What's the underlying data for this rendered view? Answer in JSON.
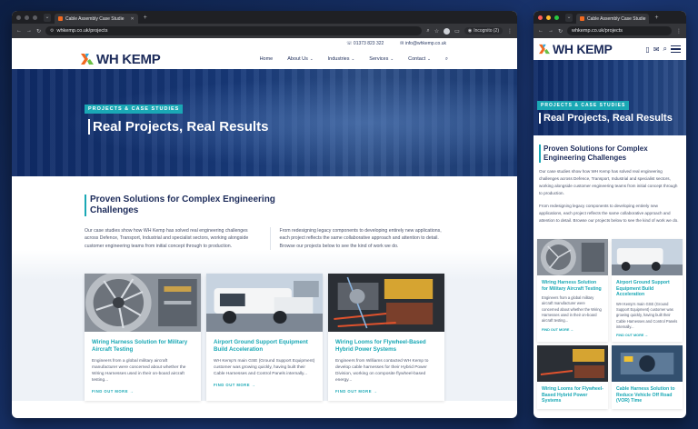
{
  "browser": {
    "tab_title": "Cable Assembly Case Studie",
    "url": "whkemp.co.uk/projects",
    "incognito_label": "Incognito (2)"
  },
  "header": {
    "phone": "01373 823 322",
    "email": "info@whkemp.co.uk",
    "logo_text": "WH KEMP",
    "menu": [
      {
        "label": "Home"
      },
      {
        "label": "About Us"
      },
      {
        "label": "Industries"
      },
      {
        "label": "Services"
      },
      {
        "label": "Contact"
      }
    ]
  },
  "hero": {
    "badge": "PROJECTS & CASE STUDIES",
    "title": "Real Projects, Real Results"
  },
  "intro": {
    "heading": "Proven Solutions for Complex Engineering Challenges",
    "para1": "Our case studies show how WH Kemp has solved real engineering challenges across Defence, Transport, Industrial and specialist sectors, working alongside customer engineering teams from initial concept through to production.",
    "para2": "From redesigning legacy components to developing entirely new applications, each project reflects the same collaborative approach and attention to detail. Browse our projects below to see the kind of work we do."
  },
  "cards": [
    {
      "title": "Wiring Harness Solution for Military Aircraft Testing",
      "text": "Engineers from a global military aircraft manufacturer were concerned about whether the Wiring Harnesses used in their on-board aircraft testing...",
      "more": "FIND OUT MORE →"
    },
    {
      "title": "Airport Ground Support Equipment Build Acceleration",
      "text": "WH Kemp's main GSE (Ground Support Equipment) customer was growing quickly, having built their Cable Harnesses and Control Panels internally...",
      "more": "FIND OUT MORE →"
    },
    {
      "title": "Wiring Looms for Flywheel-Based Hybrid Power Systems",
      "text": "Engineers from Williams contacted WH Kemp to develop cable harnesses for their Hybrid Power Division, working on composite flywheel-based energy...",
      "more": "FIND OUT MORE →"
    },
    {
      "title": "Cable Harness Solution to Reduce Vehicle Off Road (VOR) Time",
      "text": "",
      "more": ""
    }
  ],
  "mobile_cards": [
    {
      "title": "Wiring Harness Solution for Military Aircraft Testing",
      "text": "Engineers from a global military aircraft manufacturer were concerned about whether the Wiring Harnesses used in their on-board aircraft testing...",
      "more": "FIND OUT MORE →"
    },
    {
      "title": "Airport Ground Support Equipment Build Acceleration",
      "text": "WH Kemp's main GSE (Ground Support Equipment) customer was growing quickly, having built their Cable Harnesses and Control Panels internally...",
      "more": "FIND OUT MORE →"
    },
    {
      "title": "Wiring Looms for Flywheel-Based Hybrid Power Systems",
      "text": "",
      "more": ""
    },
    {
      "title": "Cable Harness Solution to Reduce Vehicle Off Road (VOR) Time",
      "text": "",
      "more": ""
    }
  ],
  "colors": {
    "accent": "#1aa8b5",
    "brand_navy": "#1c2b5a",
    "logo_orange": "#f26a21"
  }
}
